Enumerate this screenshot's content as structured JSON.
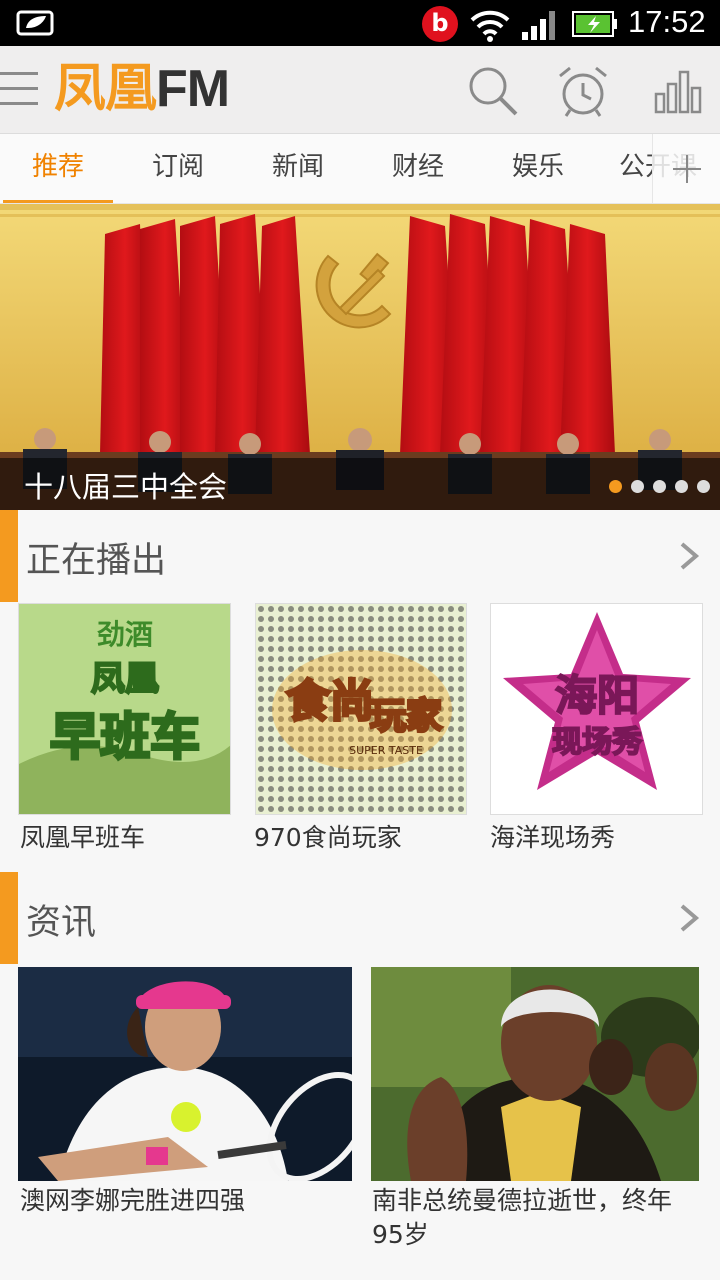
{
  "status_bar": {
    "time": "17:52",
    "icons": [
      "notification-icon",
      "beats-icon",
      "wifi-icon",
      "signal-icon",
      "battery-charging-icon"
    ]
  },
  "app_bar": {
    "logo_cn": "凤凰",
    "logo_en": "FM",
    "icons": [
      "menu-icon",
      "search-icon",
      "alarm-clock-icon",
      "bar-chart-icon"
    ]
  },
  "tabs": [
    {
      "label": "推荐",
      "active": true
    },
    {
      "label": "订阅"
    },
    {
      "label": "新闻"
    },
    {
      "label": "财经"
    },
    {
      "label": "娱乐"
    },
    {
      "label": "公开课"
    }
  ],
  "banner": {
    "caption": "十八届三中全会",
    "page_count": 5,
    "active_index": 0
  },
  "now_playing": {
    "title": "正在播出",
    "items": [
      {
        "label": "凤凰早班车",
        "art_text": [
          "劲酒",
          "凤凰",
          "早班车"
        ]
      },
      {
        "label": "970食尚玩家",
        "art_text": [
          "食尚",
          "玩家",
          "SUPER TASTE"
        ]
      },
      {
        "label": "海洋现场秀",
        "art_text": [
          "海阳",
          "现场秀"
        ]
      }
    ]
  },
  "news": {
    "title": "资讯",
    "items": [
      {
        "label": "澳网李娜完胜进四强"
      },
      {
        "label": "南非总统曼德拉逝世，终年95岁"
      }
    ]
  },
  "colors": {
    "accent": "#f49a1f",
    "status_bar": "#000000",
    "app_bar": "#efeeee"
  }
}
